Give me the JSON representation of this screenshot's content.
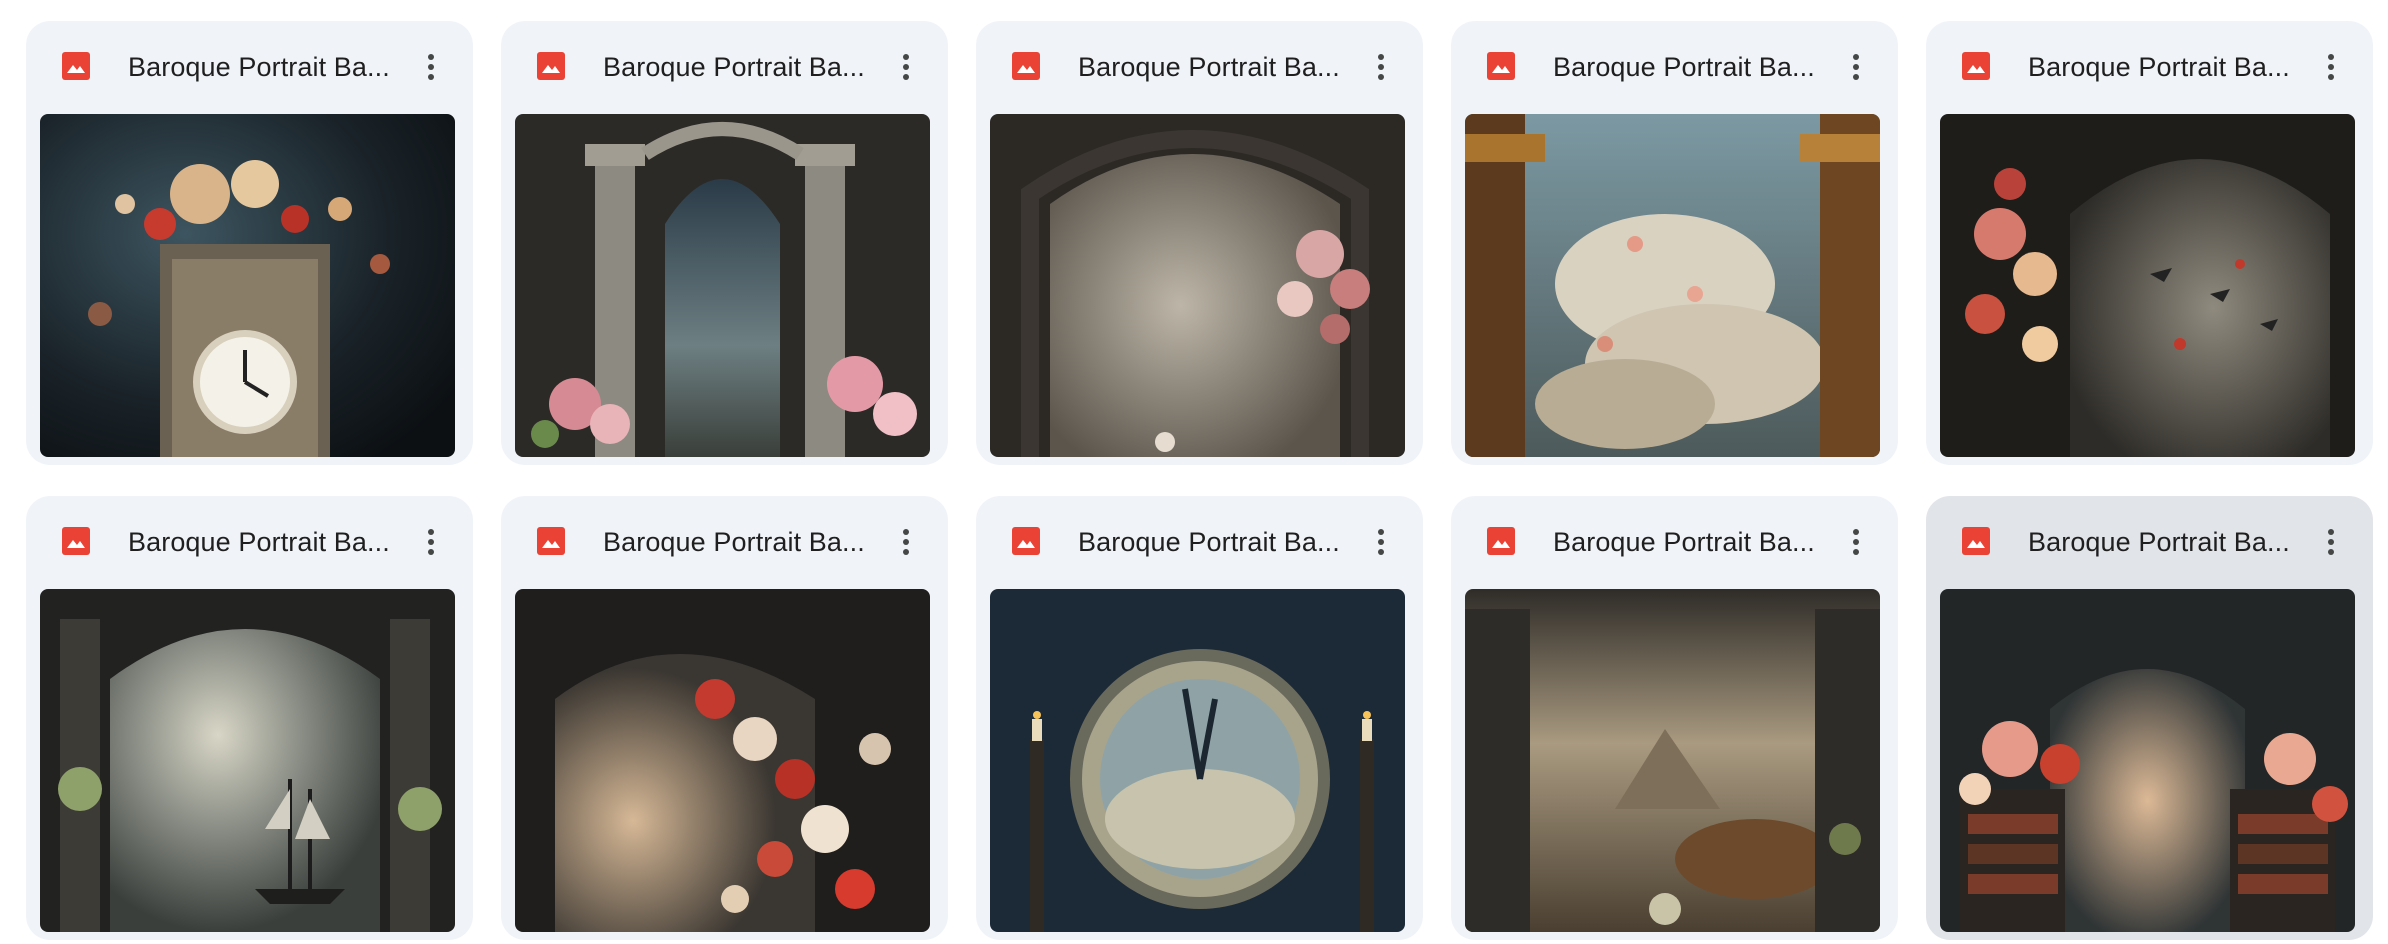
{
  "files": [
    {
      "title": "Baroque Portrait Ba...",
      "theme": "clock",
      "icon": "image-file-icon",
      "scene": "ornate-clock-with-flowers"
    },
    {
      "title": "Baroque Portrait Ba...",
      "theme": "arch",
      "icon": "image-file-icon",
      "scene": "stone-arch-with-columns-and-flowers"
    },
    {
      "title": "Baroque Portrait Ba...",
      "theme": "misty-arch",
      "icon": "image-file-icon",
      "scene": "misty-arch-with-flowers"
    },
    {
      "title": "Baroque Portrait Ba...",
      "theme": "sky",
      "icon": "image-file-icon",
      "scene": "golden-columns-with-cloudy-sky"
    },
    {
      "title": "Baroque Portrait Ba...",
      "theme": "birds",
      "icon": "image-file-icon",
      "scene": "arch-with-flowers-and-birds"
    },
    {
      "title": "Baroque Portrait Ba...",
      "theme": "ship",
      "icon": "image-file-icon",
      "scene": "arch-with-sailing-ship"
    },
    {
      "title": "Baroque Portrait Ba...",
      "theme": "blossom",
      "icon": "image-file-icon",
      "scene": "blossom-tree-in-arch"
    },
    {
      "title": "Baroque Portrait Ba...",
      "theme": "big-clock",
      "icon": "image-file-icon",
      "scene": "large-clock-with-candles"
    },
    {
      "title": "Baroque Portrait Ba...",
      "theme": "mountain",
      "icon": "image-file-icon",
      "scene": "columns-with-mountain-landscape"
    },
    {
      "title": "Baroque Portrait Ba...",
      "theme": "library",
      "icon": "image-file-icon",
      "scene": "bookshelves-with-flowers",
      "hovered": true
    }
  ],
  "colors": {
    "card_bg": "#f0f4f9",
    "card_hover_bg": "#e1e4e9",
    "image_icon": "#ea4335",
    "title_text": "#1f1f1f",
    "more_icon": "#444746"
  }
}
